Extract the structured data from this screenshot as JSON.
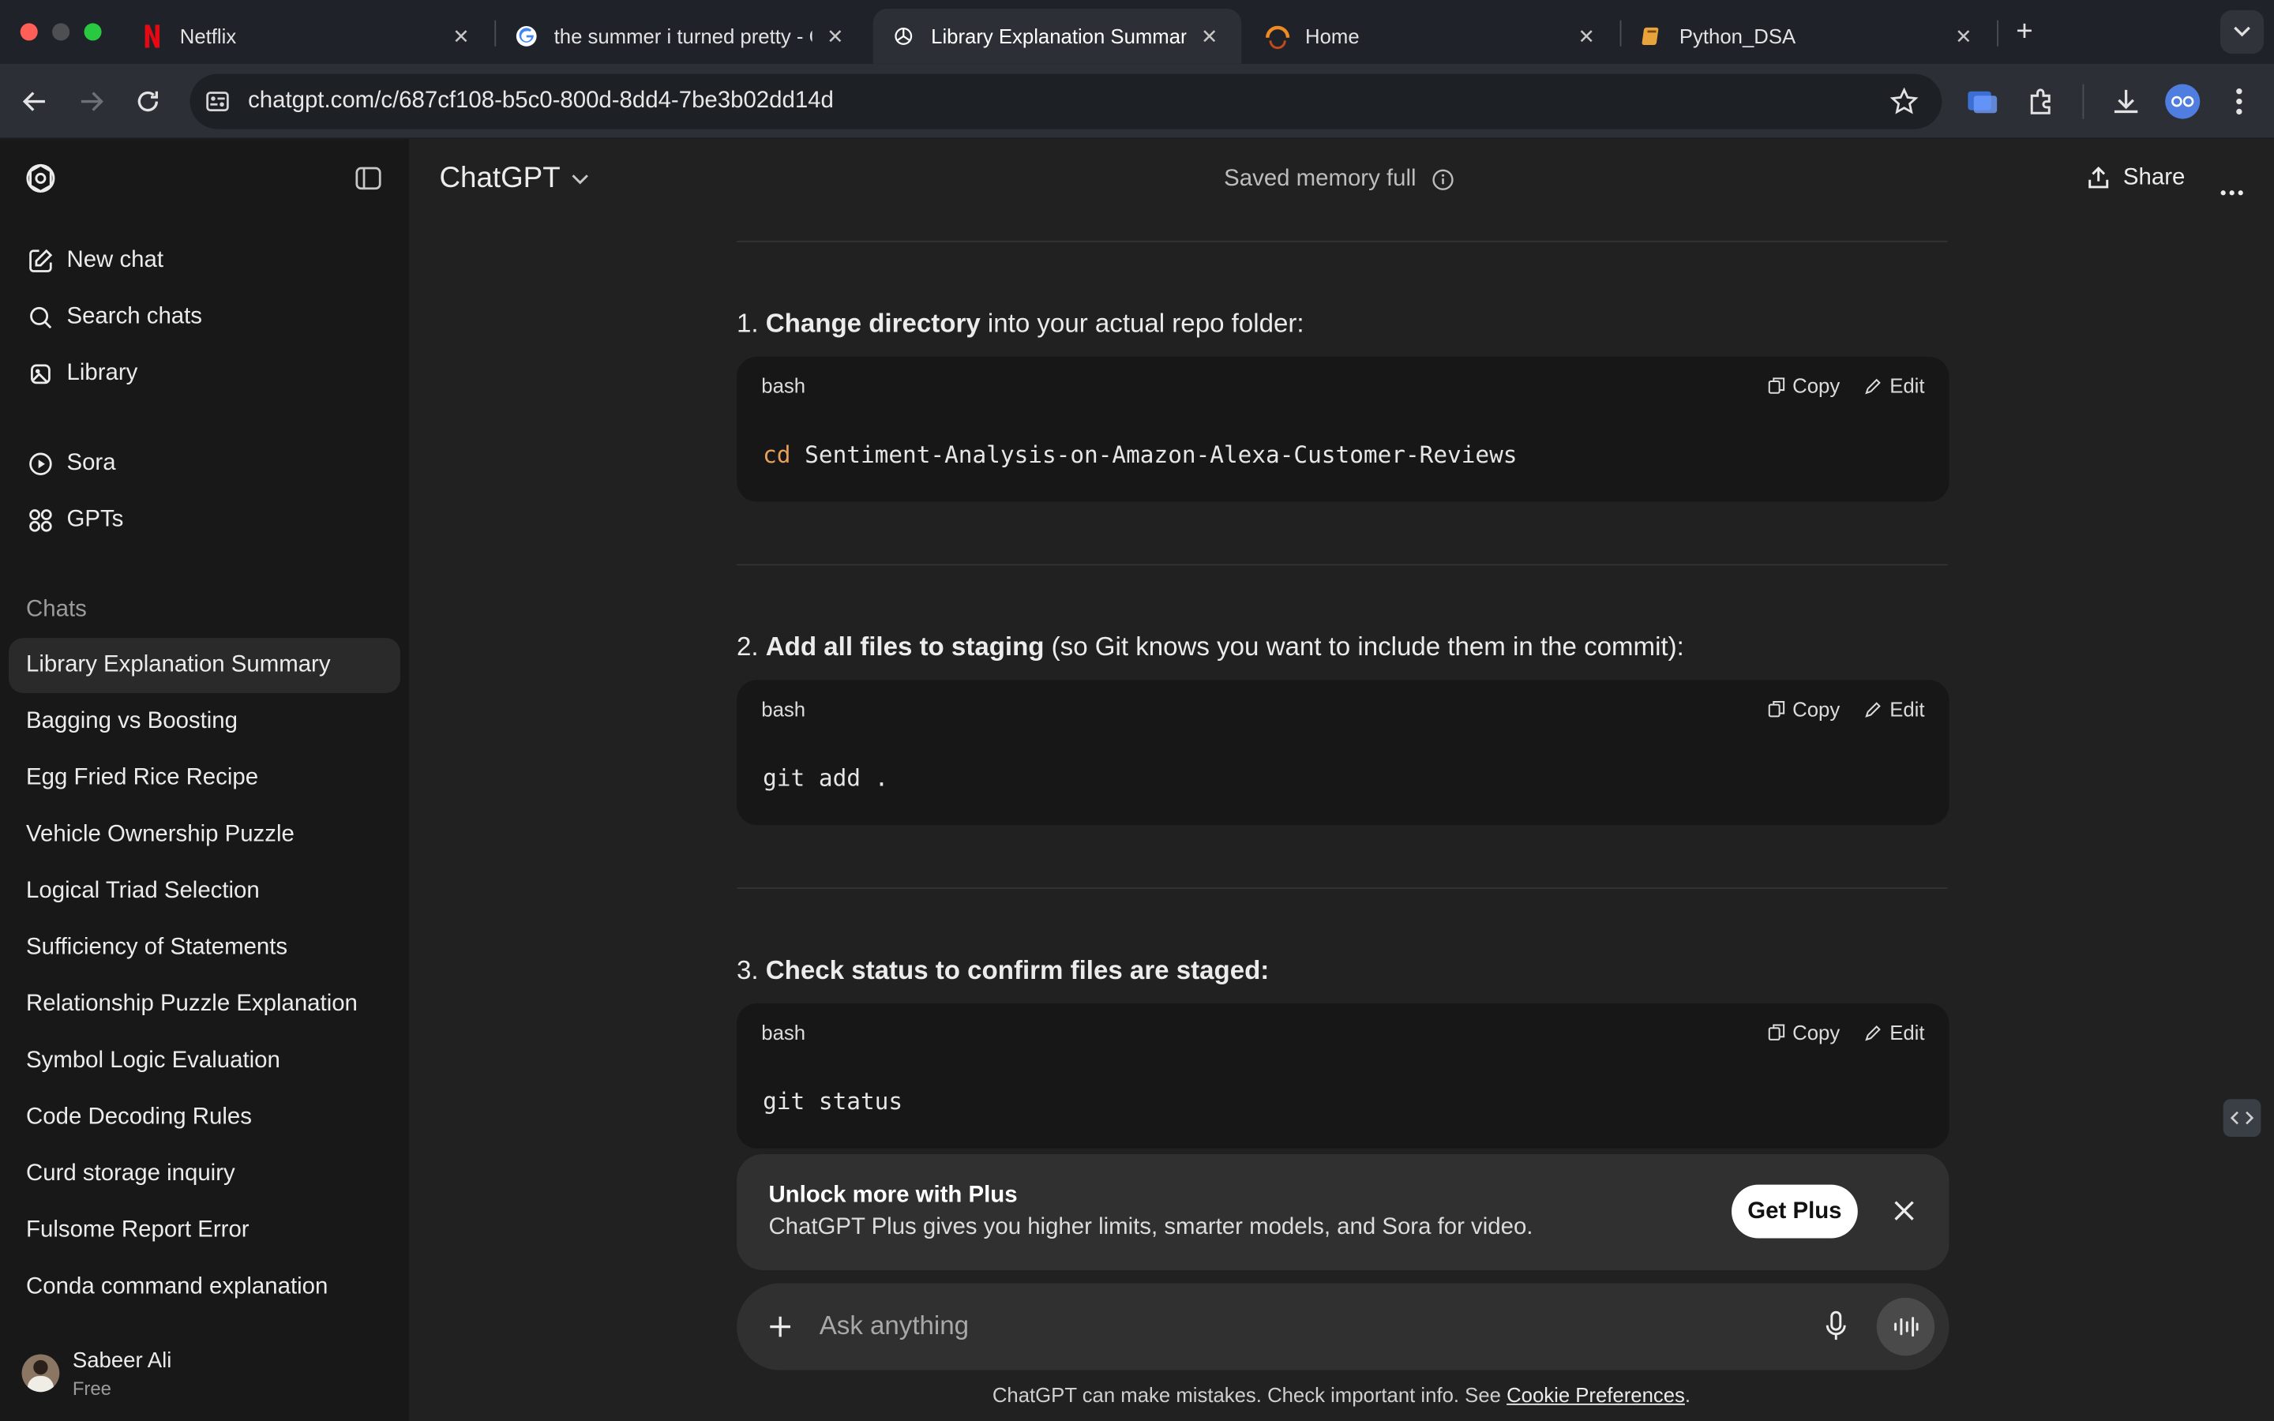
{
  "browser": {
    "tabs": [
      {
        "title": "Netflix",
        "icon": "netflix-icon"
      },
      {
        "title": "the summer i turned pretty - G",
        "icon": "google-icon"
      },
      {
        "title": "Library Explanation Summary",
        "icon": "chatgpt-icon",
        "active": true
      },
      {
        "title": "Home",
        "icon": "home-ring-icon"
      },
      {
        "title": "Python_DSA",
        "icon": "book-icon"
      }
    ],
    "url": "chatgpt.com/c/687cf108-b5c0-800d-8dd4-7be3b02dd14d"
  },
  "sidebar": {
    "nav": [
      {
        "label": "New chat",
        "icon": "edit-icon"
      },
      {
        "label": "Search chats",
        "icon": "search-icon"
      },
      {
        "label": "Library",
        "icon": "library-icon"
      }
    ],
    "apps": [
      {
        "label": "Sora",
        "icon": "play-circle-icon"
      },
      {
        "label": "GPTs",
        "icon": "grid-icon"
      }
    ],
    "chats_heading": "Chats",
    "chats": [
      "Library Explanation Summary",
      "Bagging vs Boosting",
      "Egg Fried Rice Recipe",
      "Vehicle Ownership Puzzle",
      "Logical Triad Selection",
      "Sufficiency of Statements",
      "Relationship Puzzle Explanation",
      "Symbol Logic Evaluation",
      "Code Decoding Rules",
      "Curd storage inquiry",
      "Fulsome Report Error",
      "Conda command explanation"
    ],
    "user": {
      "name": "Sabeer Ali",
      "plan": "Free"
    }
  },
  "header": {
    "model": "ChatGPT",
    "memory_status": "Saved memory full",
    "share_label": "Share"
  },
  "steps": [
    {
      "prefix": "1. ",
      "bold": "Change directory",
      "rest": " into your actual repo folder:",
      "lang": "bash",
      "code_kw": "cd",
      "code": " Sentiment-Analysis-on-Amazon-Alexa-Customer-Reviews"
    },
    {
      "prefix": "2. ",
      "bold": "Add all files to staging",
      "rest": " (so Git knows you want to include them in the commit):",
      "lang": "bash",
      "code_kw": "",
      "code": "git add ."
    },
    {
      "prefix": "3. ",
      "bold": "Check status to confirm files are staged:",
      "rest": "",
      "lang": "bash",
      "code_kw": "",
      "code": "git status"
    }
  ],
  "code_actions": {
    "copy": "Copy",
    "edit": "Edit"
  },
  "plus_banner": {
    "title": "Unlock more with Plus",
    "body": "ChatGPT Plus gives you higher limits, smarter models, and Sora for video.",
    "button": "Get Plus"
  },
  "composer": {
    "placeholder": "Ask anything"
  },
  "disclaimer": {
    "text": "ChatGPT can make mistakes. Check important info. See ",
    "link": "Cookie Preferences",
    "end": "."
  }
}
